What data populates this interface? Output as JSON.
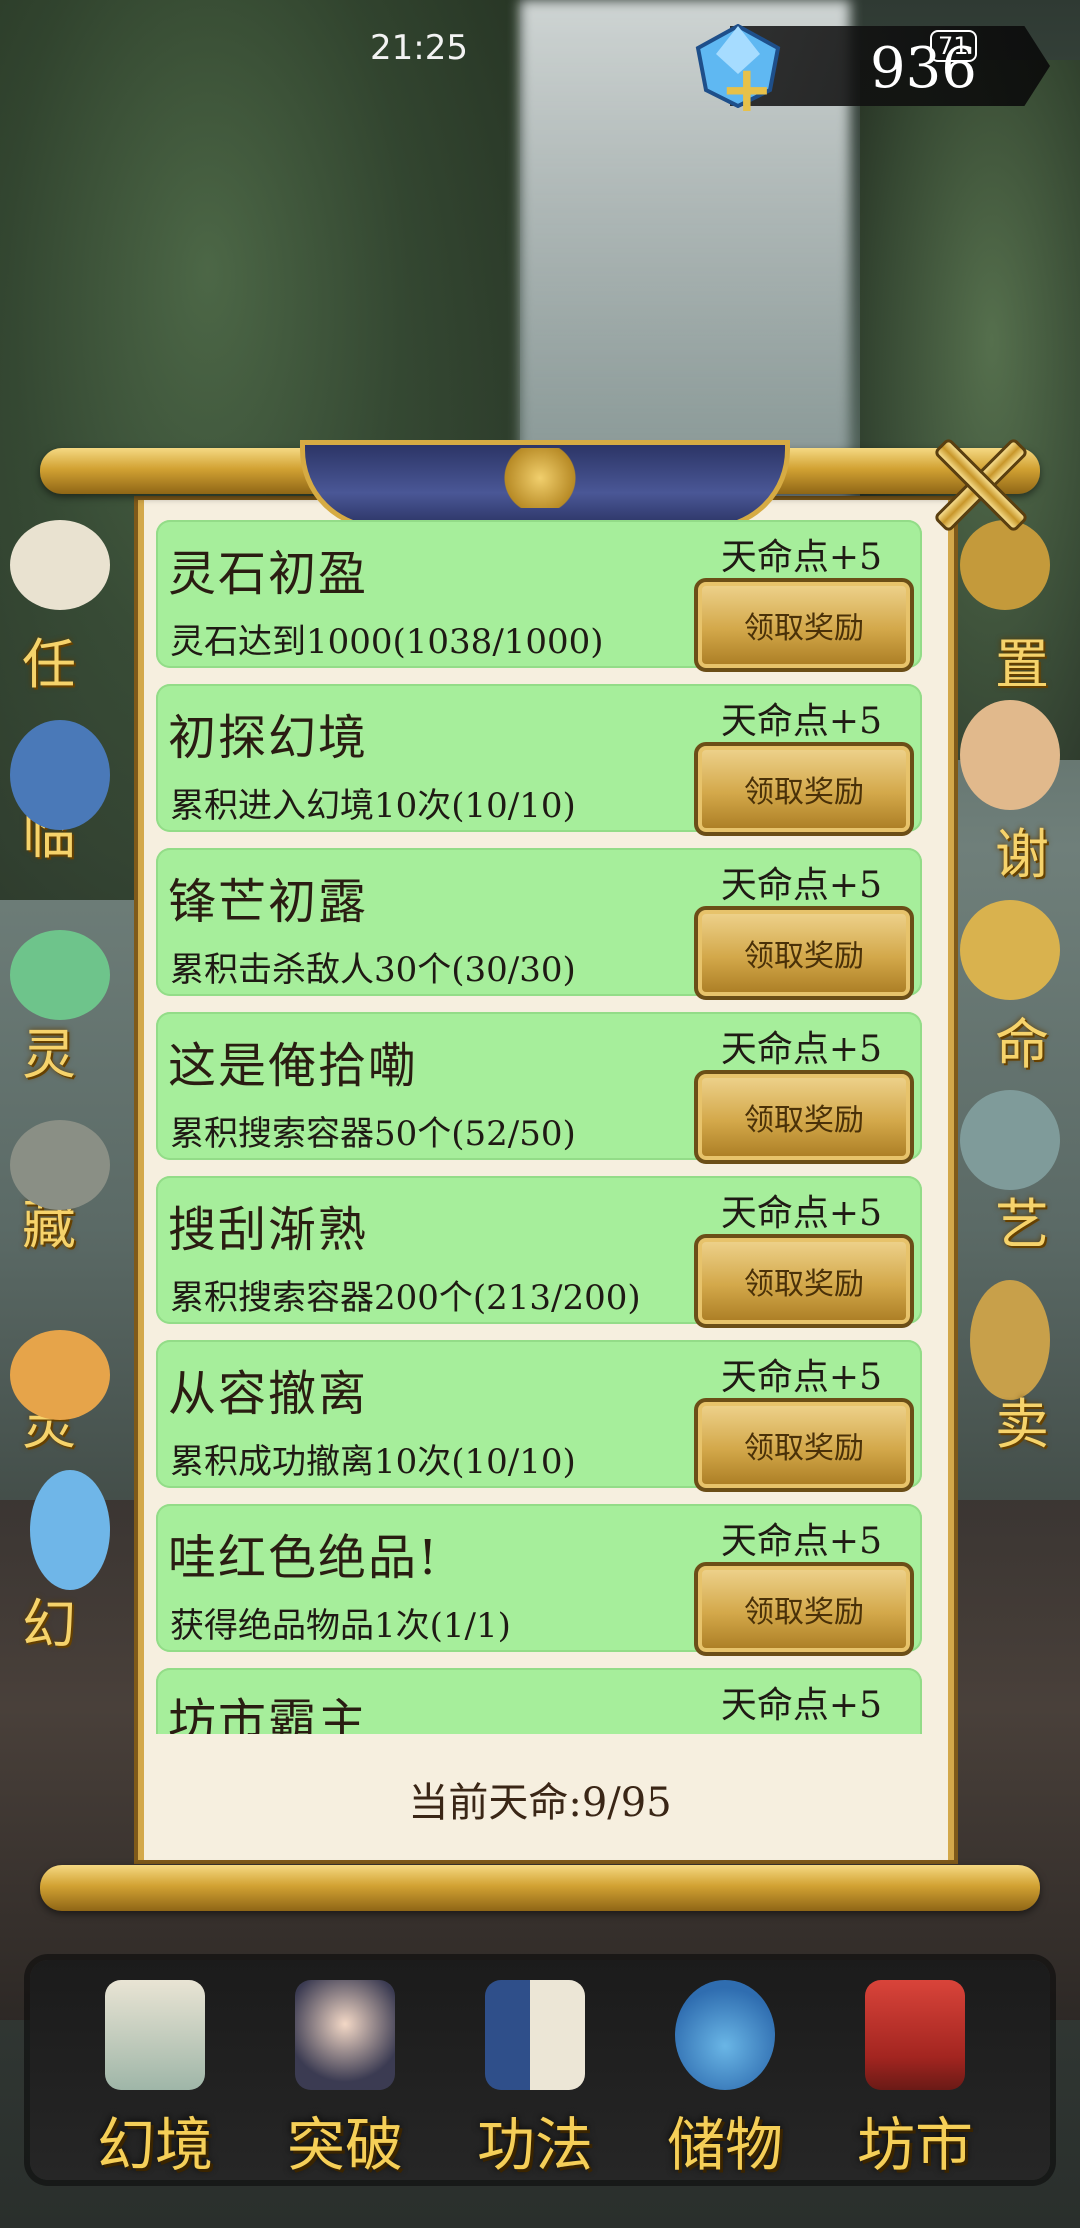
{
  "status_bar": {
    "time": "21:25"
  },
  "currency": {
    "gem_count": "936",
    "battery": "71"
  },
  "side_menu_left": [
    "任",
    "临",
    "灵",
    "藏",
    "灵",
    "幻"
  ],
  "side_menu_right": [
    "置",
    "谢",
    "命",
    "艺",
    "卖"
  ],
  "tasks": [
    {
      "title": "灵石初盈",
      "reward": "天命点+5",
      "desc": "灵石达到1000(1038/1000)",
      "button": "领取奖励"
    },
    {
      "title": "初探幻境",
      "reward": "天命点+5",
      "desc": "累积进入幻境10次(10/10)",
      "button": "领取奖励"
    },
    {
      "title": "锋芒初露",
      "reward": "天命点+5",
      "desc": "累积击杀敌人30个(30/30)",
      "button": "领取奖励"
    },
    {
      "title": "这是俺拾嘞",
      "reward": "天命点+5",
      "desc": "累积搜索容器50个(52/50)",
      "button": "领取奖励"
    },
    {
      "title": "搜刮渐熟",
      "reward": "天命点+5",
      "desc": "累积搜索容器200个(213/200)",
      "button": "领取奖励"
    },
    {
      "title": "从容撤离",
      "reward": "天命点+5",
      "desc": "累积成功撤离10次(10/10)",
      "button": "领取奖励"
    },
    {
      "title": "哇红色绝品!",
      "reward": "天命点+5",
      "desc": "获得绝品物品1次(1/1)",
      "button": "领取奖励"
    },
    {
      "title": "坊市霸主",
      "reward": "天命点+5",
      "desc": "",
      "button": ""
    }
  ],
  "footer": {
    "current_destiny": "当前天命:9/95"
  },
  "bottom_nav": [
    {
      "label": "幻境",
      "icon": "scroll-painting-icon"
    },
    {
      "label": "突破",
      "icon": "cultivator-avatar-icon"
    },
    {
      "label": "功法",
      "icon": "book-icon"
    },
    {
      "label": "储物",
      "icon": "bag-icon"
    },
    {
      "label": "坊市",
      "icon": "market-gate-icon"
    }
  ],
  "colors": {
    "card_bg": "#a6ee9b",
    "gold": "#d3a84a",
    "nav_text": "#f5cf58"
  }
}
